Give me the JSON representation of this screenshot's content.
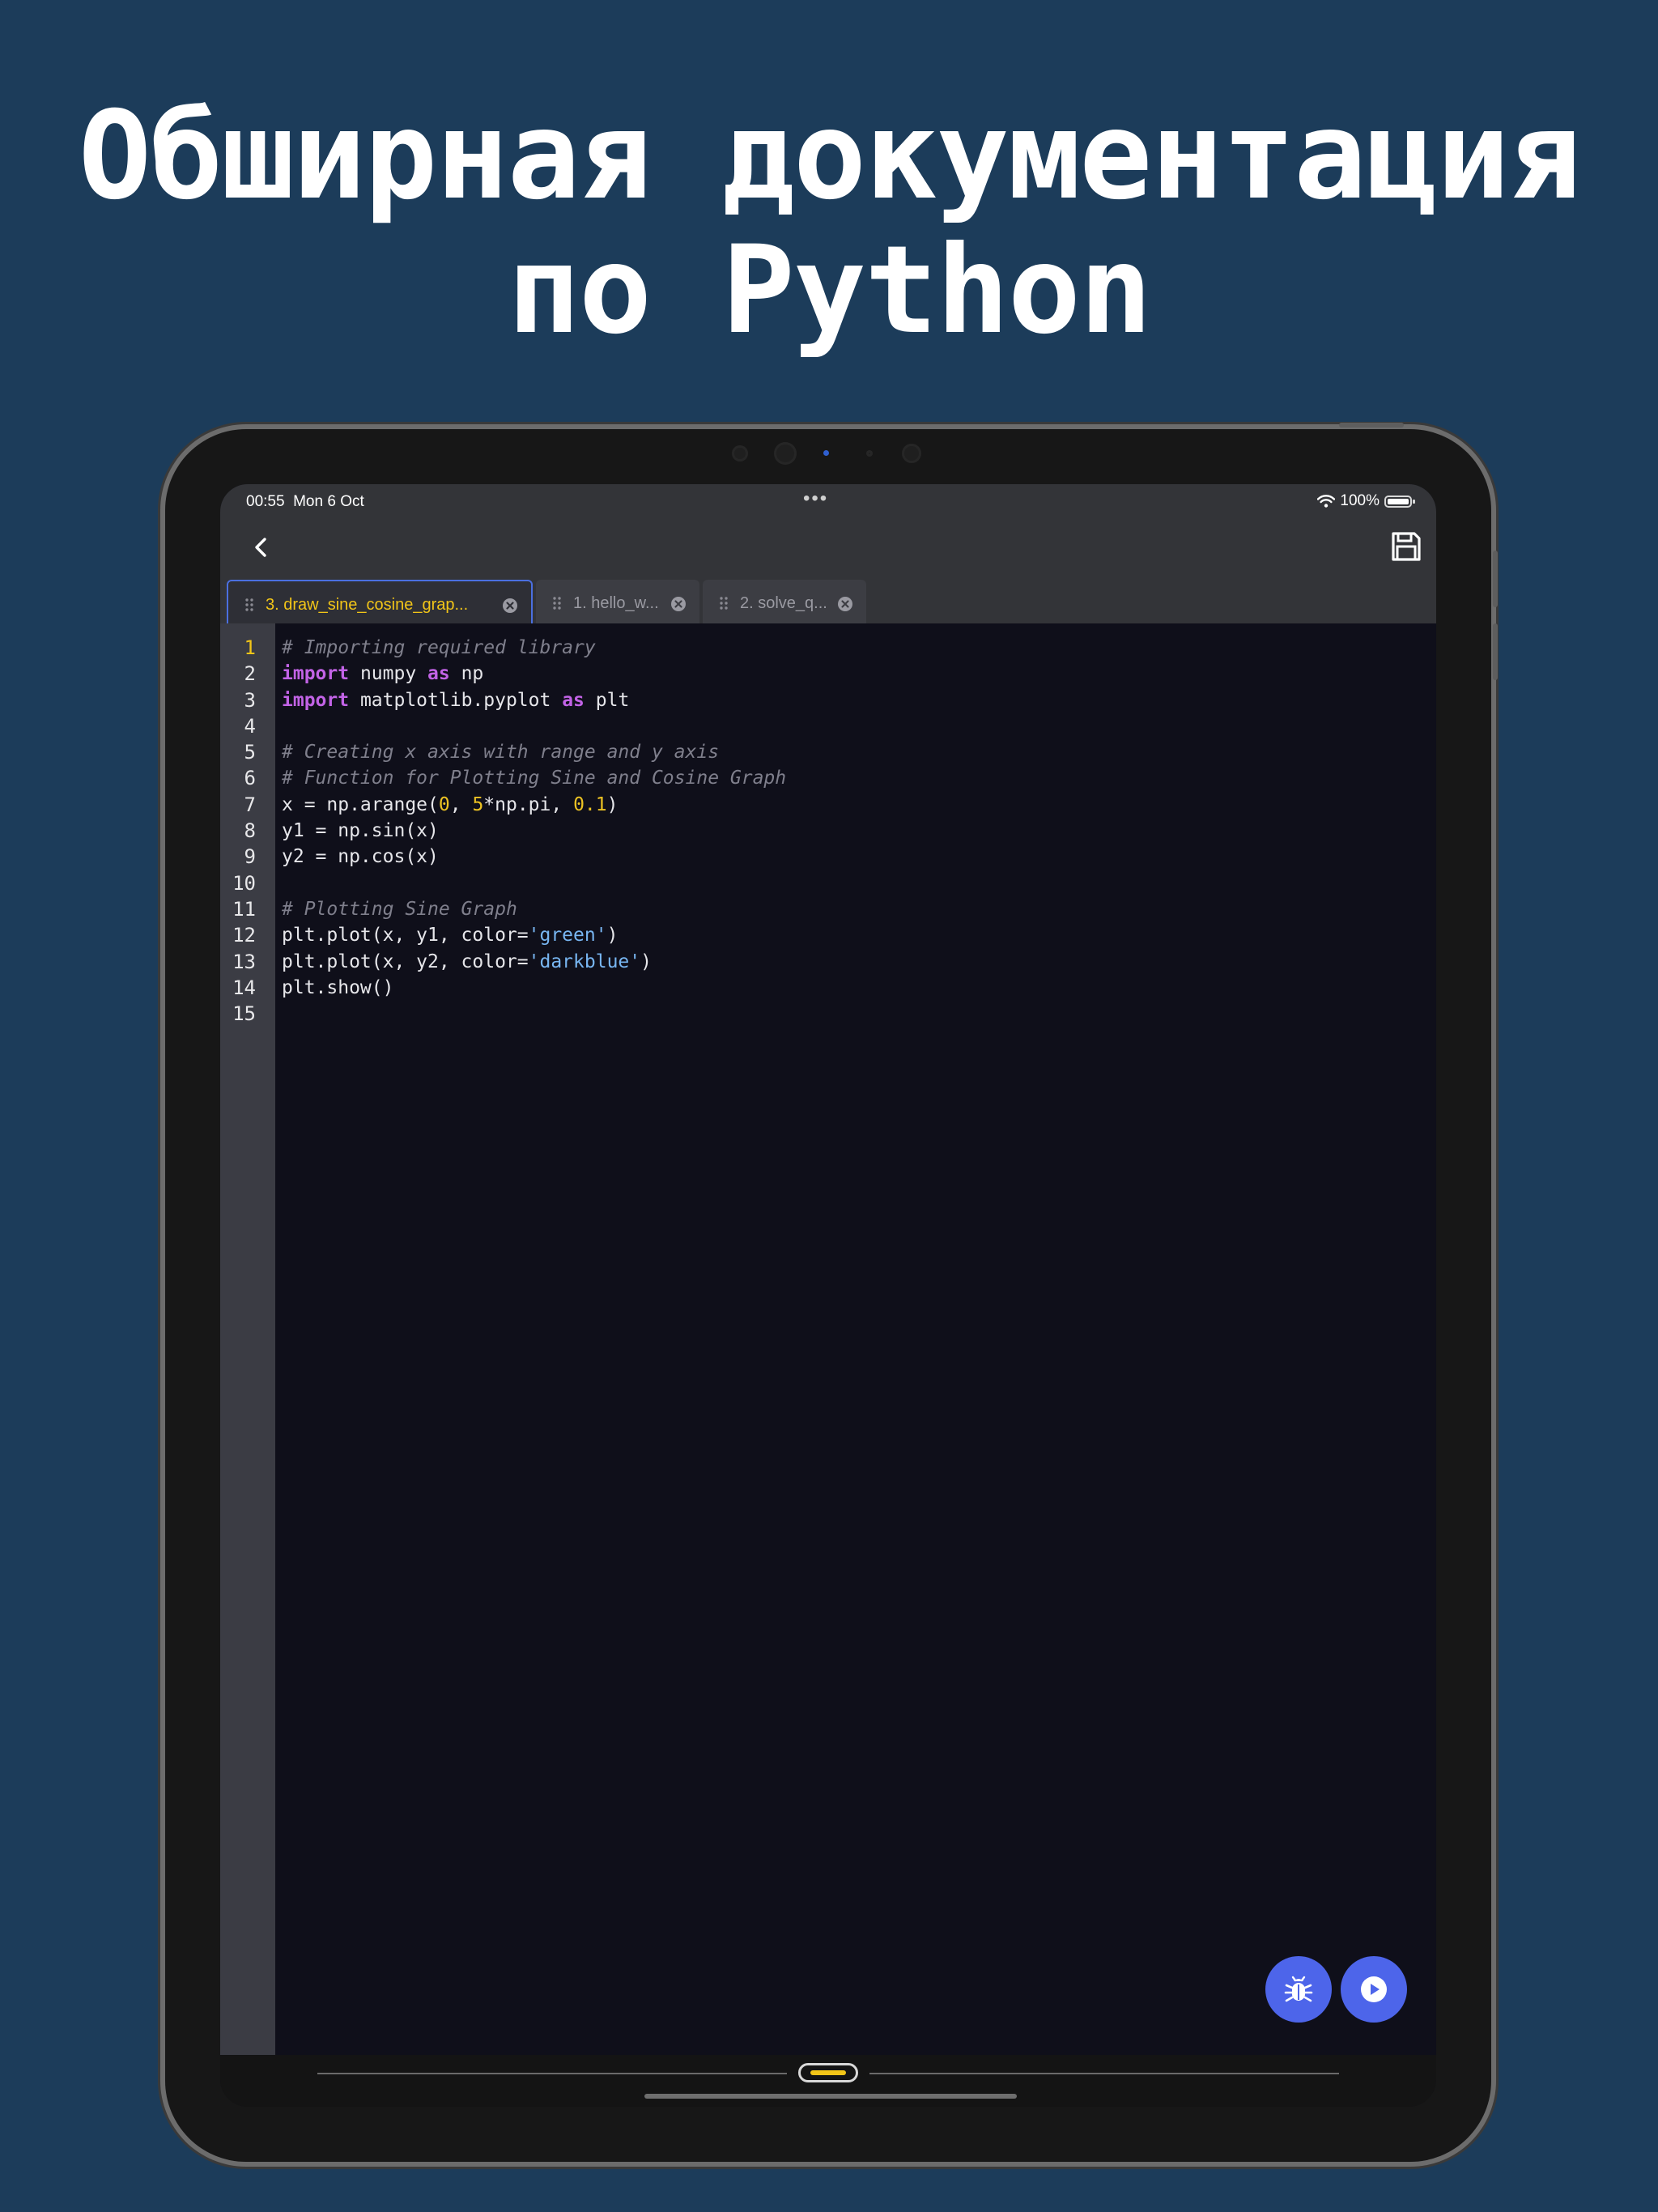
{
  "headline": {
    "line1": "Обширная документация",
    "line2": "по Python"
  },
  "status_bar": {
    "time": "00:55",
    "date": "Mon 6 Oct",
    "battery": "100%"
  },
  "tabs": [
    {
      "label": "3. draw_sine_cosine_grap...",
      "active": true
    },
    {
      "label": "1. hello_w...",
      "active": false
    },
    {
      "label": "2. solve_q...",
      "active": false
    }
  ],
  "editor": {
    "current_line": 1,
    "line_numbers": [
      "1",
      "2",
      "3",
      "4",
      "5",
      "6",
      "7",
      "8",
      "9",
      "10",
      "11",
      "12",
      "13",
      "14",
      "15"
    ],
    "lines": [
      [
        {
          "t": "cm",
          "v": "# Importing required library"
        }
      ],
      [
        {
          "t": "kw",
          "v": "import"
        },
        {
          "t": "tx",
          "v": " numpy "
        },
        {
          "t": "kw",
          "v": "as"
        },
        {
          "t": "tx",
          "v": " np"
        }
      ],
      [
        {
          "t": "kw",
          "v": "import"
        },
        {
          "t": "tx",
          "v": " matplotlib.pyplot "
        },
        {
          "t": "kw",
          "v": "as"
        },
        {
          "t": "tx",
          "v": " plt"
        }
      ],
      [],
      [
        {
          "t": "cm",
          "v": "# Creating x axis with range and y axis"
        }
      ],
      [
        {
          "t": "cm",
          "v": "# Function for Plotting Sine and Cosine Graph"
        }
      ],
      [
        {
          "t": "tx",
          "v": "x = np.arange("
        },
        {
          "t": "num",
          "v": "0"
        },
        {
          "t": "tx",
          "v": ", "
        },
        {
          "t": "num",
          "v": "5"
        },
        {
          "t": "tx",
          "v": "*np.pi, "
        },
        {
          "t": "num",
          "v": "0.1"
        },
        {
          "t": "tx",
          "v": ")"
        }
      ],
      [
        {
          "t": "tx",
          "v": "y1 = np.sin(x)"
        }
      ],
      [
        {
          "t": "tx",
          "v": "y2 = np.cos(x)"
        }
      ],
      [],
      [
        {
          "t": "cm",
          "v": "# Plotting Sine Graph"
        }
      ],
      [
        {
          "t": "tx",
          "v": "plt.plot(x, y1, color="
        },
        {
          "t": "str",
          "v": "'green'"
        },
        {
          "t": "tx",
          "v": ")"
        }
      ],
      [
        {
          "t": "tx",
          "v": "plt.plot(x, y2, color="
        },
        {
          "t": "str",
          "v": "'darkblue'"
        },
        {
          "t": "tx",
          "v": ")"
        }
      ],
      [
        {
          "t": "tx",
          "v": "plt.show()"
        }
      ],
      []
    ]
  },
  "icons": {
    "back": "chevron-left-icon",
    "save": "floppy-disk-icon",
    "debug": "bug-icon",
    "run": "play-circle-icon"
  },
  "colors": {
    "background": "#1c3c5a",
    "accent": "#4d65ea",
    "active_tab_text": "#f2c518",
    "keyword": "#c263e6",
    "string": "#78b6f2",
    "number": "#ecc223",
    "comment": "#7f7f8c"
  }
}
